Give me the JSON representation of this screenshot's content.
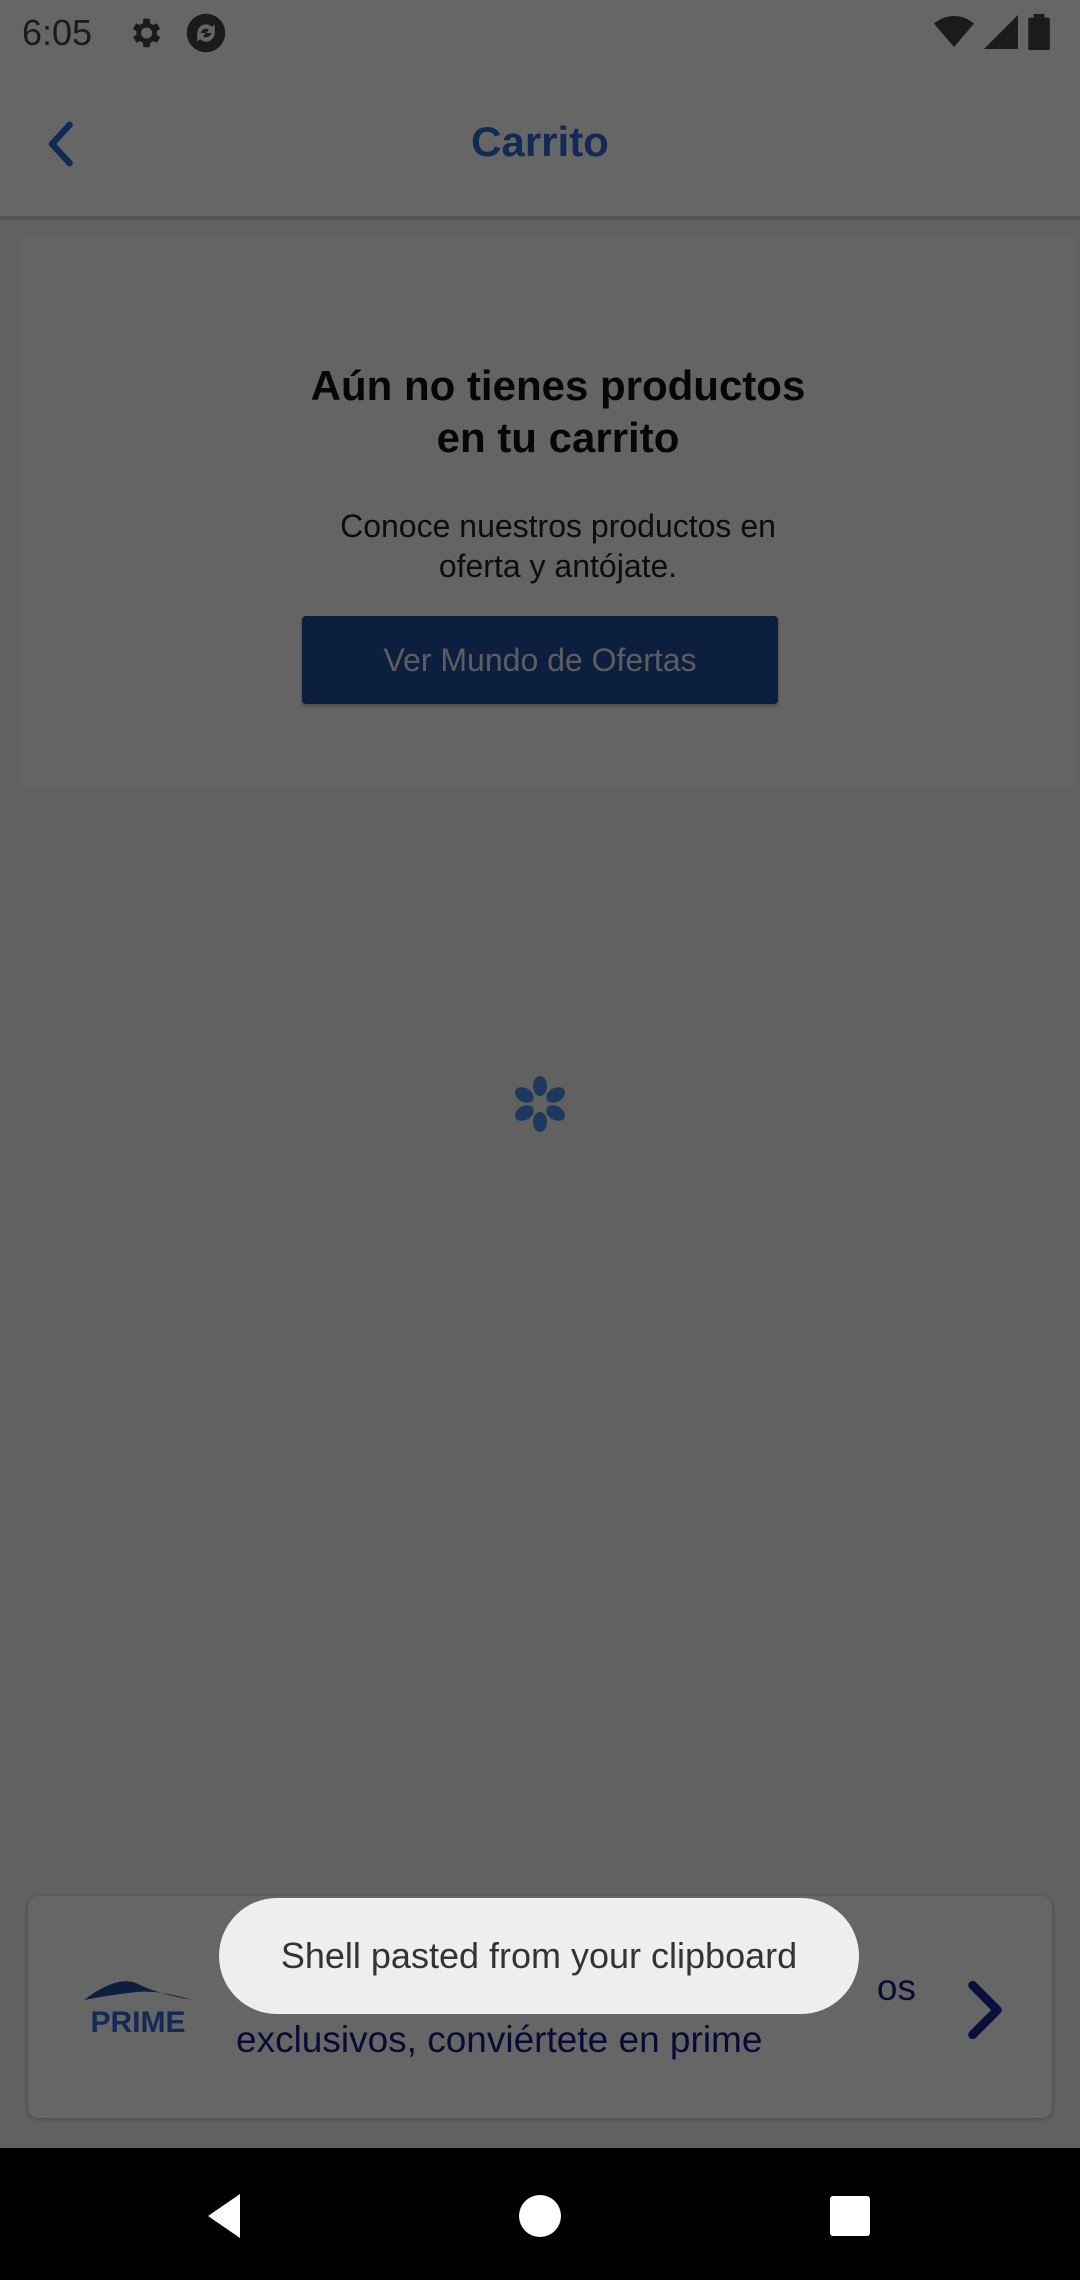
{
  "status_bar": {
    "time": "6:05"
  },
  "header": {
    "title": "Carrito"
  },
  "empty_state": {
    "title_line1": "Aún no tienes productos",
    "title_line2": "en tu carrito",
    "subtitle_line1": "Conoce nuestros productos en",
    "subtitle_line2": "oferta y antójate.",
    "cta_label": "Ver Mundo de Ofertas"
  },
  "prime_banner": {
    "logo_text": "PRIME",
    "text_line1": "os",
    "text_line2": "exclusivos, conviértete en prime"
  },
  "toast": {
    "message": "Shell pasted from your clipboard"
  },
  "colors": {
    "brand_blue": "#2e6bd6",
    "button_blue": "#1e4f9e",
    "prime_navy": "#1a1a8a"
  },
  "icons": [
    "settings-gear-icon",
    "sync-icon",
    "wifi-icon",
    "signal-icon",
    "battery-icon",
    "back-chevron-icon",
    "loading-spinner-icon",
    "chevron-right-icon",
    "nav-back-icon",
    "nav-home-icon",
    "nav-recents-icon"
  ]
}
